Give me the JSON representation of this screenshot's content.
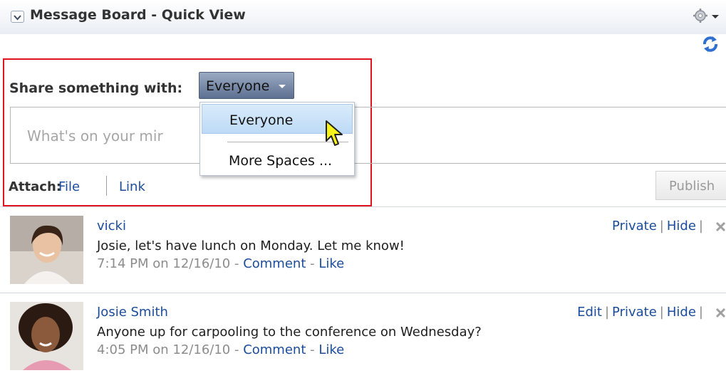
{
  "header": {
    "title": "Message Board - Quick View",
    "collapse_icon": "chevron-down-icon",
    "gear_icon": "gear-icon",
    "refresh_icon": "refresh-icon"
  },
  "share": {
    "label": "Share something with:",
    "selected_audience": "Everyone",
    "placeholder": "What's on your mir",
    "attach_label": "Attach:",
    "attach_file": "File",
    "attach_link": "Link",
    "publish": "Publish"
  },
  "dropdown": {
    "options": [
      "Everyone",
      "More Spaces ..."
    ]
  },
  "posts": [
    {
      "user": "vicki",
      "text": "Josie, let's have lunch on Monday. Let me know!",
      "time": "7:14 PM on 12/16/10",
      "comment": "Comment",
      "like": "Like",
      "actions": [
        "Private",
        "Hide"
      ]
    },
    {
      "user": "Josie Smith",
      "text": "Anyone up for carpooling to the conference on Wednesday?",
      "time": "4:05 PM on 12/16/10",
      "comment": "Comment",
      "like": "Like",
      "actions": [
        "Edit",
        "Private",
        "Hide"
      ]
    }
  ],
  "colors": {
    "link": "#1b4c9c",
    "highlight_border": "#e0141f",
    "select_bg": "#6f7f9c"
  }
}
